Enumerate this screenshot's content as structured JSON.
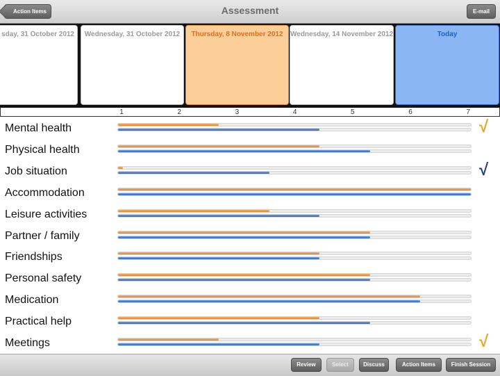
{
  "navbar": {
    "title": "Assessment",
    "back_label": "Action Items",
    "email_label": "E-mail"
  },
  "sessions": [
    {
      "label": "sday, 31 October 2012",
      "state": "normal"
    },
    {
      "label": "Wednesday, 31 October 2012",
      "state": "normal"
    },
    {
      "label": "Thursday, 8 November 2012",
      "state": "selected"
    },
    {
      "label": "Wednesday, 14 November 2012",
      "state": "normal"
    },
    {
      "label": "Today",
      "state": "today"
    }
  ],
  "scale": {
    "ticks": [
      "1",
      "2",
      "3",
      "4",
      "5",
      "6",
      "7"
    ],
    "min": 1,
    "max": 7
  },
  "domains": [
    {
      "label": "Mental health",
      "previous": 2,
      "current": 4,
      "check": "gold-check-icon"
    },
    {
      "label": "Physical health",
      "previous": 4,
      "current": 5,
      "check": ""
    },
    {
      "label": "Job situation",
      "previous": 0.1,
      "current": 3,
      "check": "navy-check-icon"
    },
    {
      "label": "Accommodation",
      "previous": 7,
      "current": 7,
      "check": ""
    },
    {
      "label": "Leisure activities",
      "previous": 3,
      "current": 4,
      "check": ""
    },
    {
      "label": "Partner / family",
      "previous": 5,
      "current": 5,
      "check": ""
    },
    {
      "label": "Friendships",
      "previous": 4,
      "current": 4,
      "check": ""
    },
    {
      "label": "Personal safety",
      "previous": 5,
      "current": 5,
      "check": ""
    },
    {
      "label": "Medication",
      "previous": 6,
      "current": 6,
      "check": ""
    },
    {
      "label": "Practical help",
      "previous": 4,
      "current": 5,
      "check": ""
    },
    {
      "label": "Meetings",
      "previous": 2,
      "current": 4,
      "check": "gold-check-icon"
    }
  ],
  "colors": {
    "previous": "#e2822e",
    "current": "#2f67c2",
    "check_gold": "#e9a51f",
    "check_navy": "#1f3f86"
  },
  "toolbar": {
    "buttons": [
      {
        "label": "Review",
        "enabled": true
      },
      {
        "label": "Select",
        "enabled": false
      },
      {
        "label": "Discuss",
        "enabled": true
      },
      {
        "label": "Action Items",
        "enabled": true
      },
      {
        "label": "Finish Session",
        "enabled": true
      }
    ]
  }
}
